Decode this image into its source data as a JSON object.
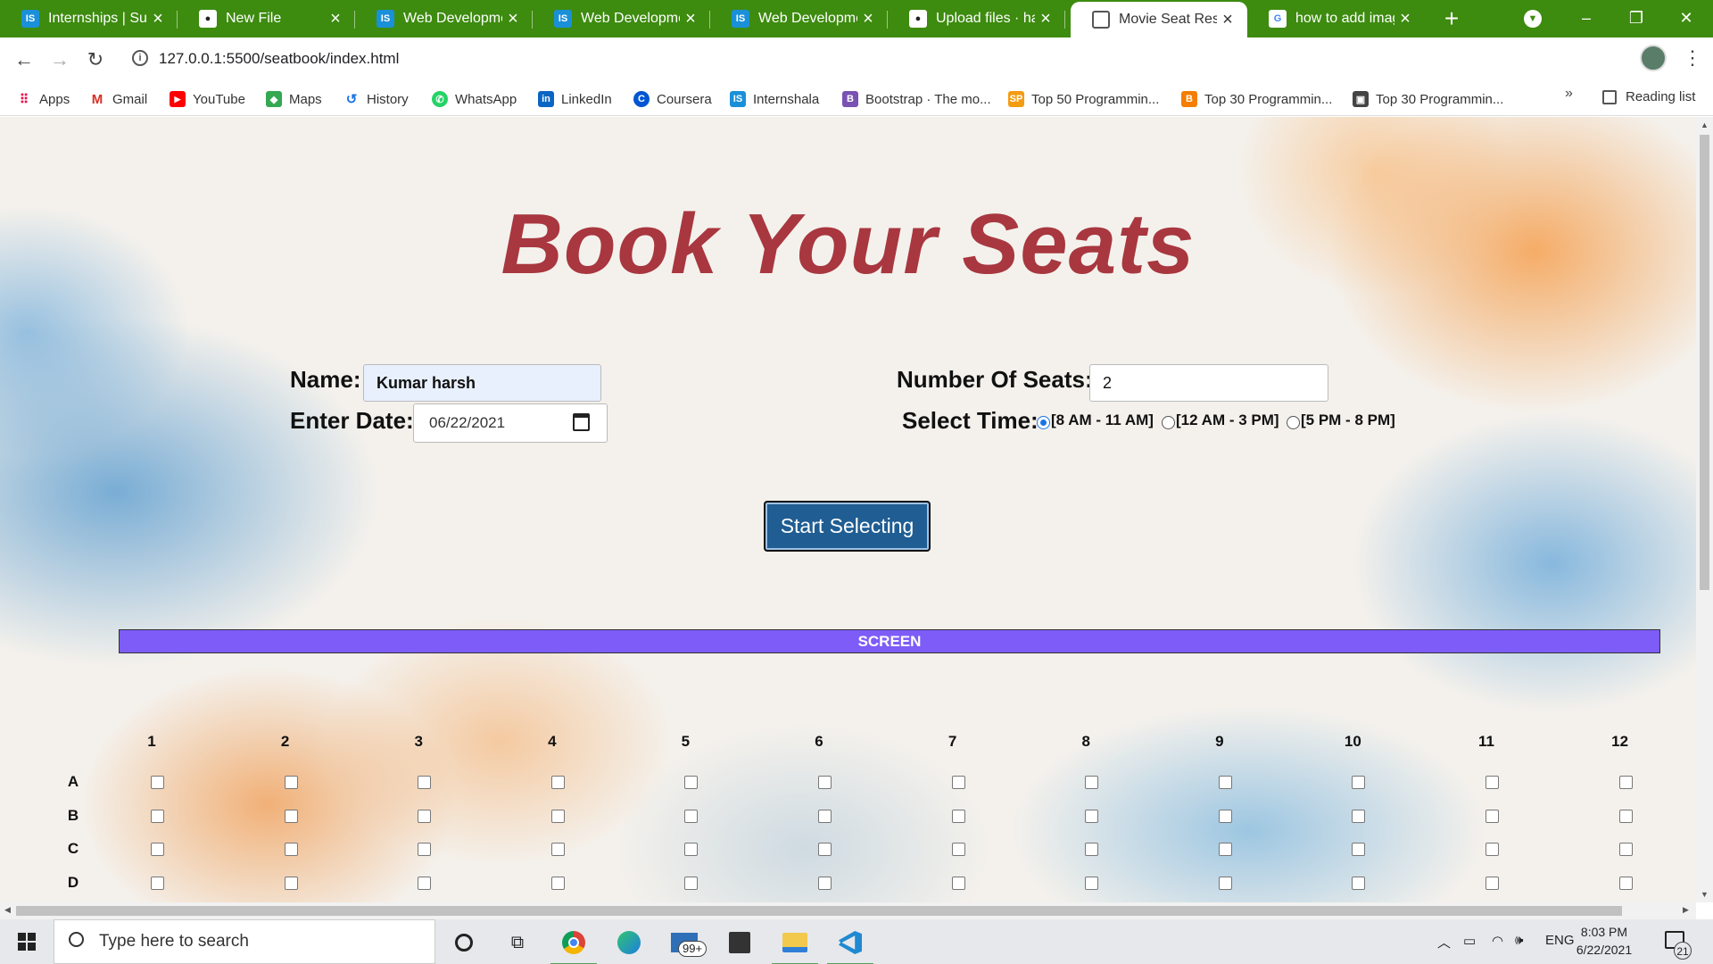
{
  "browser": {
    "tabs": [
      {
        "title": "Internships | Summer",
        "icon": "internshala-icon"
      },
      {
        "title": "New File",
        "icon": "github-icon"
      },
      {
        "title": "Web Development",
        "icon": "internshala-icon"
      },
      {
        "title": "Web Development",
        "icon": "internshala-icon"
      },
      {
        "title": "Web Development",
        "icon": "internshala-icon"
      },
      {
        "title": "Upload files · harsh",
        "icon": "github-icon"
      },
      {
        "title": "Movie Seat Reservation",
        "icon": "globe-icon",
        "active": true
      },
      {
        "title": "how to add image",
        "icon": "google-icon"
      }
    ],
    "url": "127.0.0.1:5500/seatbook/index.html",
    "bookmarks": [
      "Apps",
      "Gmail",
      "YouTube",
      "Maps",
      "History",
      "WhatsApp",
      "LinkedIn",
      "Coursera",
      "Internshala",
      "Bootstrap · The mo...",
      "Top 50 Programmin...",
      "Top 30 Programmin...",
      "Top 30 Programmin..."
    ],
    "bookmarks_overflow": "»",
    "reading_list": "Reading list"
  },
  "page": {
    "title": "Book Your Seats",
    "form": {
      "name_label": "Name:",
      "name_value": "Kumar harsh",
      "date_label": "Enter Date:",
      "date_value": "06/22/2021",
      "seats_label": "Number Of Seats:",
      "seats_value": "2",
      "time_label": "Select Time:",
      "time_options": [
        "[8 AM - 11 AM]",
        "[12 AM - 3 PM]",
        "[5 PM - 8 PM]"
      ],
      "time_selected_index": 0
    },
    "start_button": "Start Selecting",
    "screen_label": "SCREEN",
    "seat_columns": [
      "1",
      "2",
      "3",
      "4",
      "5",
      "6",
      "7",
      "8",
      "9",
      "10",
      "11",
      "12"
    ],
    "seat_rows": [
      "A",
      "B",
      "C",
      "D"
    ]
  },
  "taskbar": {
    "search_placeholder": "Type here to search",
    "mail_badge": "99+",
    "language": "ENG",
    "time": "8:03 PM",
    "date": "6/22/2021",
    "notifications": "21"
  }
}
